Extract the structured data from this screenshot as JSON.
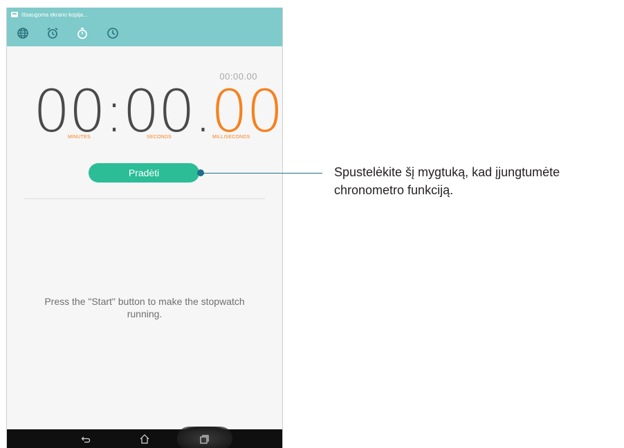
{
  "status_bar": {
    "notification_text": "Išsaugoma ekrano kopija..."
  },
  "tabs": [
    {
      "icon": "globe-icon"
    },
    {
      "icon": "alarm-clock-icon"
    },
    {
      "icon": "stopwatch-icon",
      "selected": true
    },
    {
      "icon": "timer-icon"
    }
  ],
  "stopwatch": {
    "lap_time": "00:00.00",
    "minutes": "00",
    "sep1": ":",
    "seconds": "00",
    "sep2": ".",
    "milliseconds": "00",
    "minutes_label": "MINUTES",
    "seconds_label": "SECONDS",
    "milliseconds_label": "MILLISECONDS",
    "start_label": "Pradėti",
    "hint": "Press the \"Start\" button to make the stopwatch running."
  },
  "navbar": {
    "buttons": [
      "back-icon",
      "home-icon",
      "recent-apps-icon"
    ]
  },
  "callout": {
    "text": "Spustelėkite šį mygtuką, kad įjungtumėte chronometro funkciją."
  },
  "colors": {
    "header": "#7fcaca",
    "accent_orange": "#f58220",
    "button_green": "#2cbd96",
    "callout_line": "#1f6f8b"
  }
}
